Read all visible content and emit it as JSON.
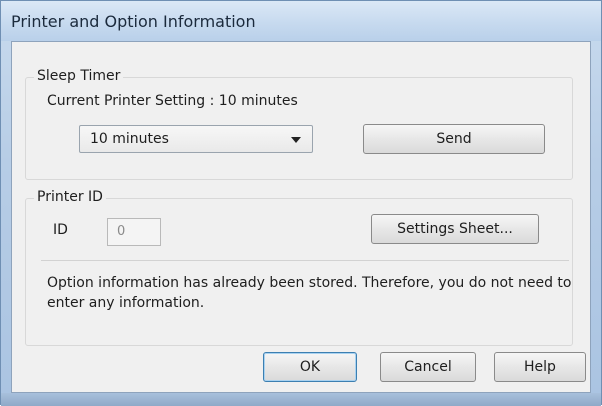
{
  "window": {
    "title": "Printer and Option Information"
  },
  "sleep_timer": {
    "group_label": "Sleep Timer",
    "current_setting_text": "Current Printer Setting : 10 minutes",
    "selected_value": "10 minutes",
    "send_label": "Send"
  },
  "printer_id": {
    "group_label": "Printer ID",
    "id_label": "ID",
    "id_value": "0",
    "settings_sheet_label": "Settings Sheet...",
    "message": "Option information has already been stored. Therefore, you do not need to enter any information."
  },
  "footer": {
    "ok_label": "OK",
    "cancel_label": "Cancel",
    "help_label": "Help"
  }
}
